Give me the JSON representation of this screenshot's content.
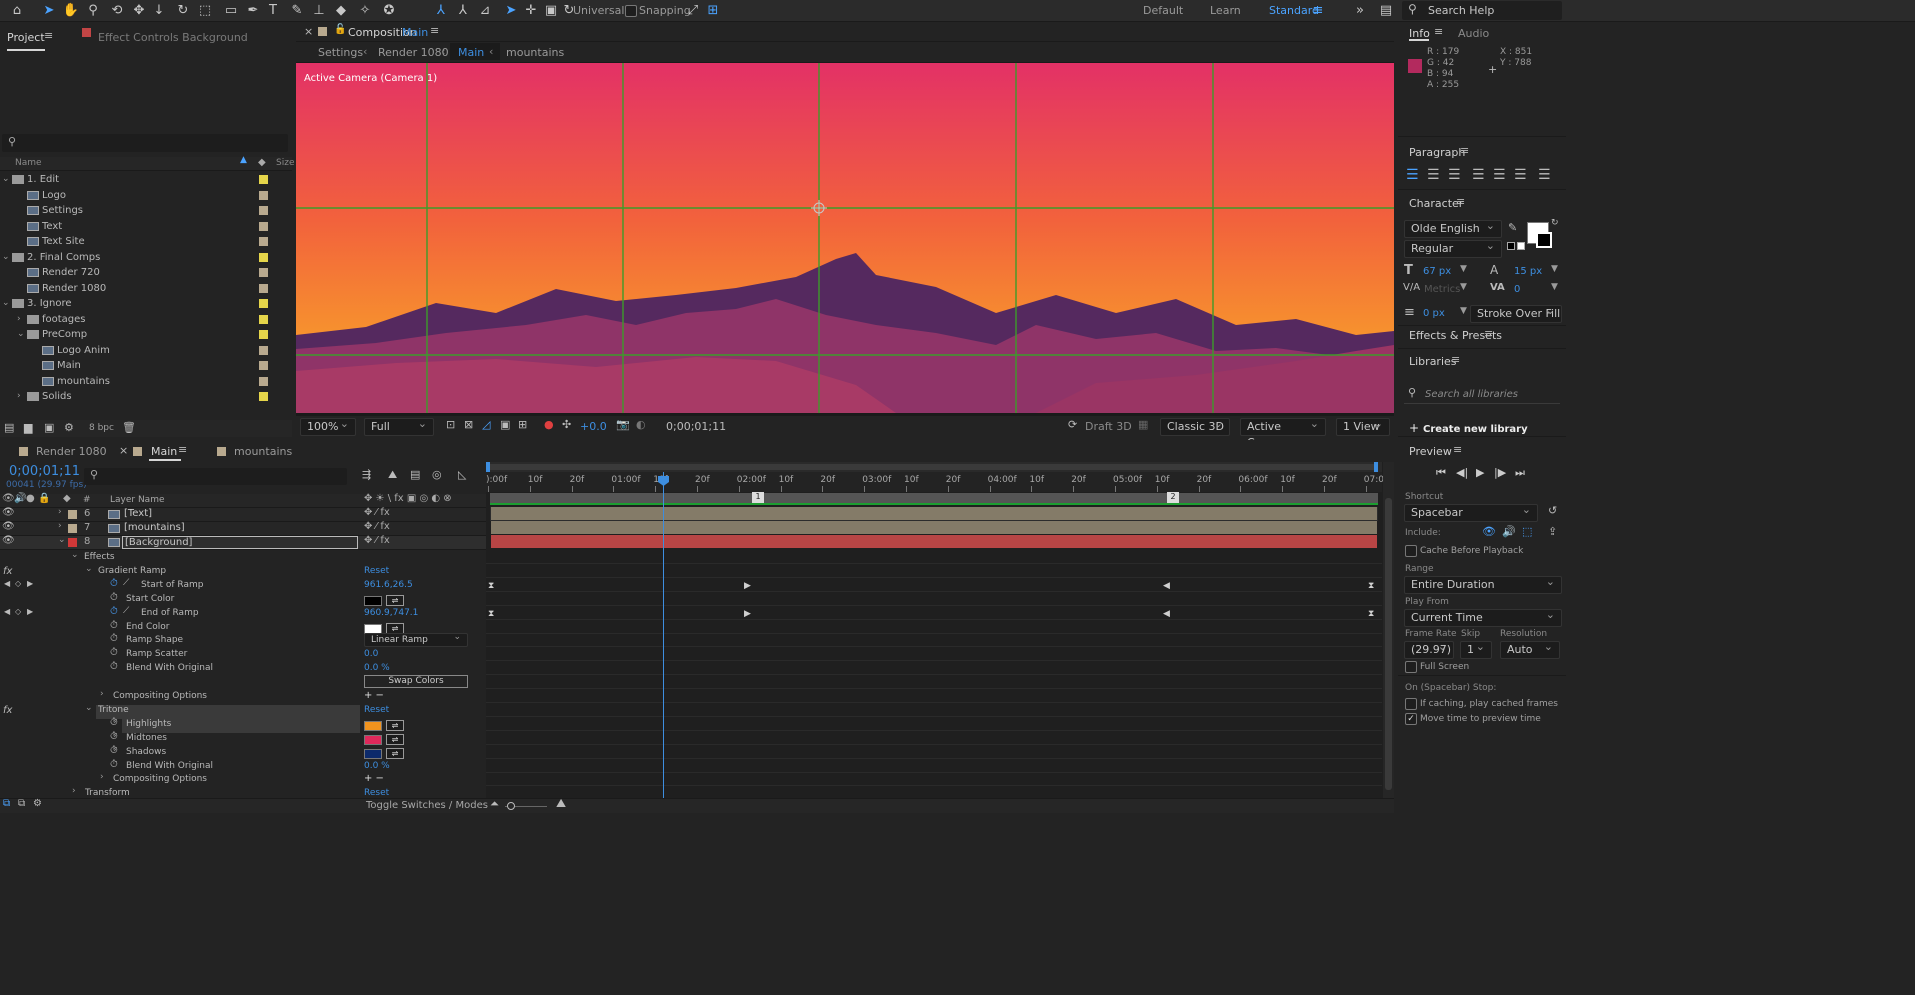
{
  "toolbar": {
    "universal_label": "Universal",
    "snapping_label": "Snapping",
    "workspaces": [
      "Default",
      "Learn",
      "Standard"
    ],
    "search_placeholder": "Search Help"
  },
  "project": {
    "tab_project": "Project",
    "tab_effect_controls": "Effect Controls Background",
    "search_value": "",
    "col_name": "Name",
    "col_size": "Size",
    "items": [
      {
        "label": "1. Edit",
        "kind": "folder",
        "indent": 0,
        "open": true,
        "color": "#e5d54a"
      },
      {
        "label": "Logo",
        "kind": "comp",
        "indent": 1,
        "color": "#b8a98e"
      },
      {
        "label": "Settings",
        "kind": "comp",
        "indent": 1,
        "color": "#b8a98e"
      },
      {
        "label": "Text",
        "kind": "comp",
        "indent": 1,
        "color": "#b8a98e"
      },
      {
        "label": "Text Site",
        "kind": "comp",
        "indent": 1,
        "color": "#b8a98e"
      },
      {
        "label": "2. Final Comps",
        "kind": "folder",
        "indent": 0,
        "open": true,
        "color": "#e5d54a"
      },
      {
        "label": "Render 720",
        "kind": "comp",
        "indent": 1,
        "color": "#b8a98e"
      },
      {
        "label": "Render 1080",
        "kind": "comp",
        "indent": 1,
        "color": "#b8a98e"
      },
      {
        "label": "3. Ignore",
        "kind": "folder",
        "indent": 0,
        "open": true,
        "color": "#e5d54a"
      },
      {
        "label": "footages",
        "kind": "folder",
        "indent": 1,
        "open": false,
        "color": "#e5d54a"
      },
      {
        "label": "PreComp",
        "kind": "folder",
        "indent": 1,
        "open": true,
        "color": "#e5d54a"
      },
      {
        "label": "Logo Anim",
        "kind": "comp",
        "indent": 2,
        "color": "#b8a98e"
      },
      {
        "label": "Main",
        "kind": "comp",
        "indent": 2,
        "color": "#b8a98e"
      },
      {
        "label": "mountains",
        "kind": "comp",
        "indent": 2,
        "color": "#b8a98e"
      },
      {
        "label": "Solids",
        "kind": "folder",
        "indent": 1,
        "open": false,
        "color": "#e5d54a"
      }
    ],
    "bpc": "8 bpc"
  },
  "composition": {
    "tab_prefix": "Composition",
    "tab_name": "Main",
    "breadcrumbs": [
      "Settings",
      "Render 1080",
      "Main",
      "mountains"
    ],
    "camera_label": "Active Camera (Camera 1)",
    "zoom": "100%",
    "quality": "Full",
    "exposure": "+0.0",
    "timecode": "0;00;01;11",
    "draft3d": "Draft 3D",
    "renderer": "Classic 3D",
    "camera_select": "Active Camer...",
    "view_select": "1 View"
  },
  "info": {
    "tab_info": "Info",
    "tab_audio": "Audio",
    "r": "R : 179",
    "g": "G : 42",
    "b": "B : 94",
    "a": "A : 255",
    "x": "X : 851",
    "y": "Y : 788",
    "swatch": "#b32a5e"
  },
  "paragraph": {
    "title": "Paragraph"
  },
  "character": {
    "title": "Character",
    "font": "Olde English",
    "style": "Regular",
    "size": "67 px",
    "leading": "15 px",
    "kerning": "Metrics",
    "tracking": "0",
    "stroke": "0 px",
    "stroke_mode": "Stroke Over Fill"
  },
  "effects_presets": {
    "title": "Effects & Presets"
  },
  "libraries": {
    "title": "Libraries",
    "search_placeholder": "Search all libraries",
    "create_label": "Create new library"
  },
  "preview": {
    "title": "Preview",
    "shortcut_label": "Shortcut",
    "shortcut": "Spacebar",
    "include_label": "Include:",
    "cache_label": "Cache Before Playback",
    "range_label": "Range",
    "range": "Entire Duration",
    "playfrom_label": "Play From",
    "playfrom": "Current Time",
    "framerate_label": "Frame Rate",
    "skip_label": "Skip",
    "resolution_label": "Resolution",
    "framerate": "(29.97)",
    "skip": "1",
    "resolution": "Auto",
    "fullscreen_label": "Full Screen",
    "stop_label": "On (Spacebar) Stop:",
    "cached_label": "If caching, play cached frames",
    "movetime_label": "Move time to preview time"
  },
  "timeline": {
    "tabs": [
      "Render 1080",
      "Main",
      "mountains"
    ],
    "timecode": "0;00;01;11",
    "frames": "00041 (29.97 fps)",
    "search_value": "",
    "layer_name_header": "Layer Name",
    "hash": "#",
    "layers": [
      {
        "num": "6",
        "name": "[Text]",
        "color": "#b8a98e"
      },
      {
        "num": "7",
        "name": "[mountains]",
        "color": "#b8a98e"
      },
      {
        "num": "8",
        "name": "[Background]",
        "color": "#d13838"
      }
    ],
    "ruler": [
      "):00f",
      "10f",
      "20f",
      "01:00f",
      "10f",
      "20f",
      "02:00f",
      "10f",
      "20f",
      "03:00f",
      "10f",
      "20f",
      "04:00f",
      "10f",
      "20f",
      "05:00f",
      "10f",
      "20f",
      "06:00f",
      "10f",
      "20f",
      "07:00"
    ],
    "marker1": "1",
    "marker2": "2",
    "props": {
      "effects": "Effects",
      "gradient_ramp": "Gradient Ramp",
      "reset": "Reset",
      "start_of_ramp": "Start of Ramp",
      "start_of_ramp_val": "961.6,26.5",
      "start_color": "Start Color",
      "start_color_val": "#000000",
      "end_of_ramp": "End of Ramp",
      "end_of_ramp_val": "960.9,747.1",
      "end_color": "End Color",
      "end_color_val": "#ffffff",
      "ramp_shape": "Ramp Shape",
      "ramp_shape_val": "Linear Ramp",
      "ramp_scatter": "Ramp Scatter",
      "ramp_scatter_val": "0.0",
      "blend_with_original": "Blend With Original",
      "blend_val": "0.0 %",
      "swap_colors": "Swap Colors",
      "compositing_options": "Compositing Options",
      "tritone": "Tritone",
      "highlights": "Highlights",
      "highlights_val": "#f0931e",
      "midtones": "Midtones",
      "midtones_val": "#e0295b",
      "shadows": "Shadows",
      "shadows_val": "#0c2a6b",
      "blend_with_original2": "Blend With Original",
      "blend_val2": "0.0 %",
      "compositing_options2": "Compositing Options",
      "transform": "Transform",
      "fx": "fx",
      "plus_minus": "+ −"
    },
    "toggle_label": "Toggle Switches / Modes"
  }
}
